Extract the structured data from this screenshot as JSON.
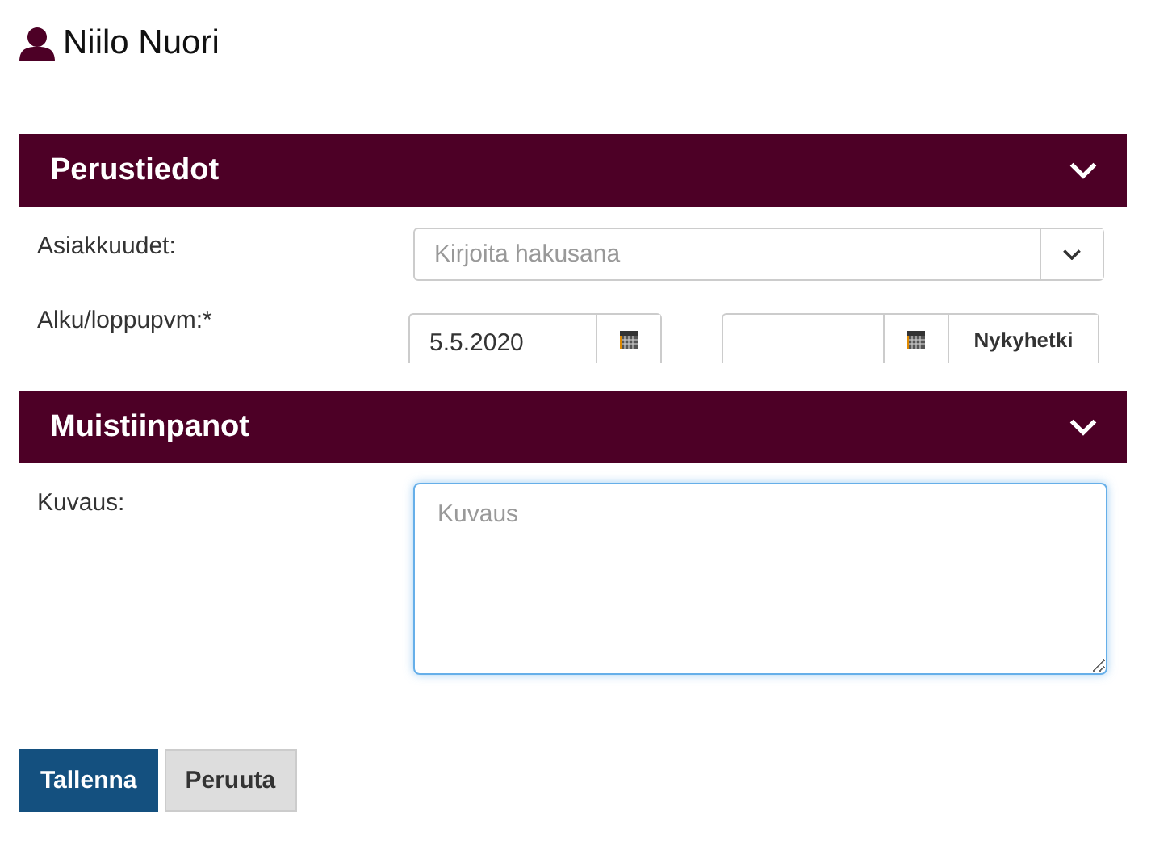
{
  "user": {
    "name": "Niilo Nuori"
  },
  "sections": [
    {
      "title": "Perustiedot",
      "expanded": true,
      "fields": [
        {
          "kind": "combo",
          "label": "Asiakkuudet:",
          "placeholder": "Kirjoita hakusana"
        },
        {
          "kind": "daterange",
          "label": "Alku/loppupvm:*",
          "start": "5.5.2020",
          "now_button": "Nykyhetki"
        }
      ]
    },
    {
      "title": "Muistiinpanot",
      "expanded": true,
      "fields": [
        {
          "kind": "textarea",
          "label": "Kuvaus:",
          "placeholder": "Kuvaus",
          "focused": true
        }
      ]
    }
  ],
  "buttons": [
    {
      "label": "Tallenna",
      "kind": "primary"
    },
    {
      "label": "Peruuta",
      "kind": "secondary"
    }
  ]
}
